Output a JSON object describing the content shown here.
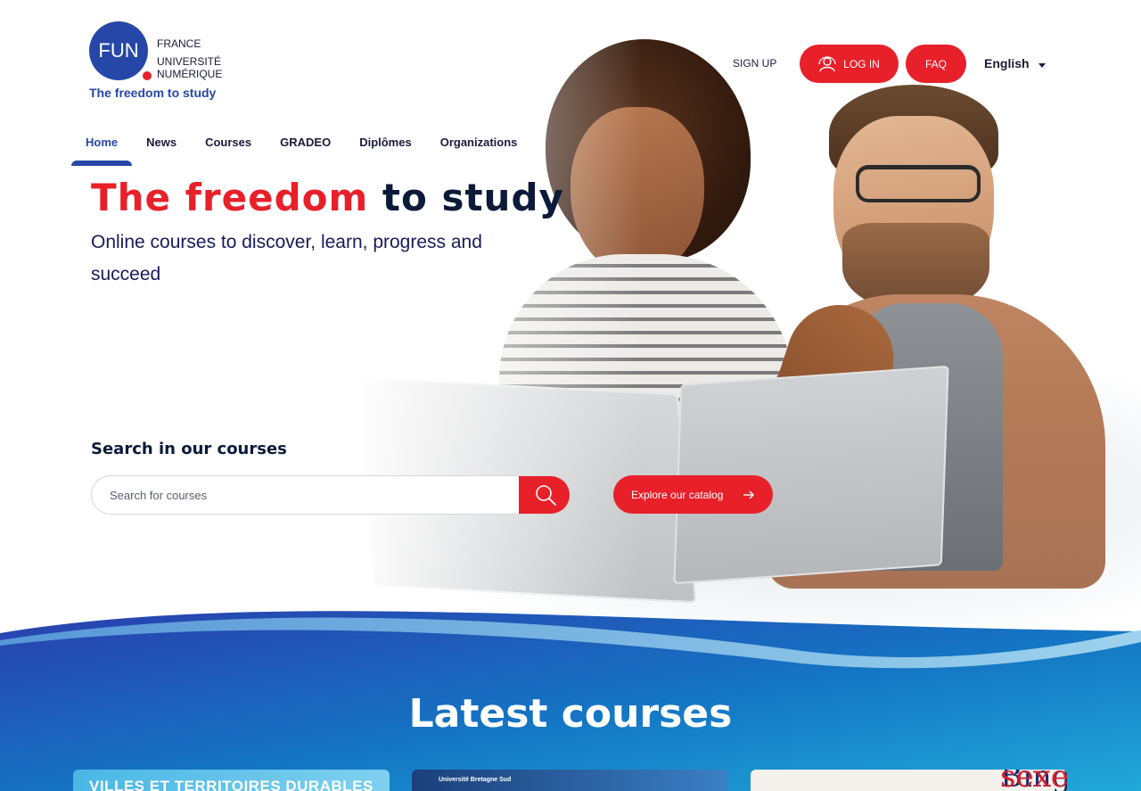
{
  "brand": {
    "logo_mark": "FUN",
    "logo_words": [
      "FRANCE",
      "UNIVERSITÉ",
      "NUMÉRIQUE"
    ],
    "tagline": "The freedom to study",
    "primary_color": "#2747a8",
    "accent_color": "#e8202a"
  },
  "header": {
    "signup_label": "SIGN UP",
    "login_label": "LOG IN",
    "faq_label": "FAQ",
    "language": "English"
  },
  "nav": {
    "items": [
      {
        "label": "Home",
        "active": true
      },
      {
        "label": "News"
      },
      {
        "label": "Courses"
      },
      {
        "label": "GRADEO"
      },
      {
        "label": "Diplômes"
      },
      {
        "label": "Organizations"
      }
    ]
  },
  "hero": {
    "title_highlight": "The freedom",
    "title_rest": "to study",
    "subtitle": "Online courses to discover, learn, progress and succeed"
  },
  "search": {
    "label": "Search in our courses",
    "placeholder": "Search for courses",
    "catalog_label": "Explore our catalog"
  },
  "latest": {
    "title": "Latest courses",
    "cards": [
      {
        "text": "VILLES ET TERRITOIRES DURABLES"
      },
      {
        "text": "Université Bretagne Sud"
      },
      {
        "text_a": "Binge",
        "text_b": "sexe"
      }
    ]
  },
  "icons": {
    "login": "user-icon",
    "search": "search-icon",
    "catalog": "arrow-right-icon",
    "language": "chevron-down-icon"
  }
}
